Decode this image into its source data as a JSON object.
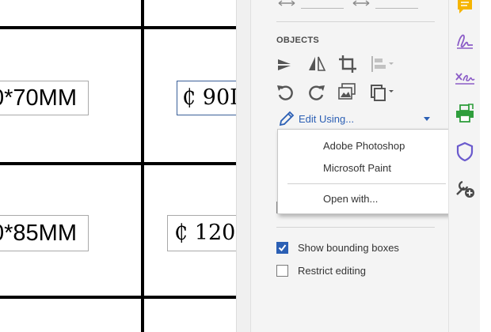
{
  "document": {
    "fields": [
      {
        "text": "0*70MM"
      },
      {
        "text": "₵ 90I"
      },
      {
        "text": "0*85MM"
      },
      {
        "text": "₵ 120"
      }
    ]
  },
  "panel": {
    "section_title": "OBJECTS",
    "tools": [
      {
        "icon": "rotate-flip-vertical-icon"
      },
      {
        "icon": "flip-horizontal-icon"
      },
      {
        "icon": "crop-icon"
      },
      {
        "icon": "align-objects-icon"
      },
      {
        "icon": "rotate-counterclockwise-icon"
      },
      {
        "icon": "rotate-clockwise-icon"
      },
      {
        "icon": "replace-image-icon"
      },
      {
        "icon": "arrange-objects-icon"
      }
    ],
    "edit_using": {
      "label": "Edit Using...",
      "menu": [
        "Adobe Photoshop",
        "Microsoft Paint",
        "Open with..."
      ]
    },
    "show_bounding_boxes": {
      "label": "Show bounding boxes",
      "checked": true
    },
    "restrict_editing": {
      "label": "Restrict editing",
      "checked": false
    }
  },
  "rail": {
    "icons": [
      "comment-icon",
      "fill-sign-icon",
      "prepare-form-icon",
      "print-production-icon",
      "protect-icon",
      "more-tools-icon"
    ]
  },
  "colors": {
    "accent": "#2b5fb4",
    "comment": "#f5b400",
    "sign": "#8b5cc7",
    "print": "#2f9e3c",
    "protect": "#6a5acd"
  }
}
